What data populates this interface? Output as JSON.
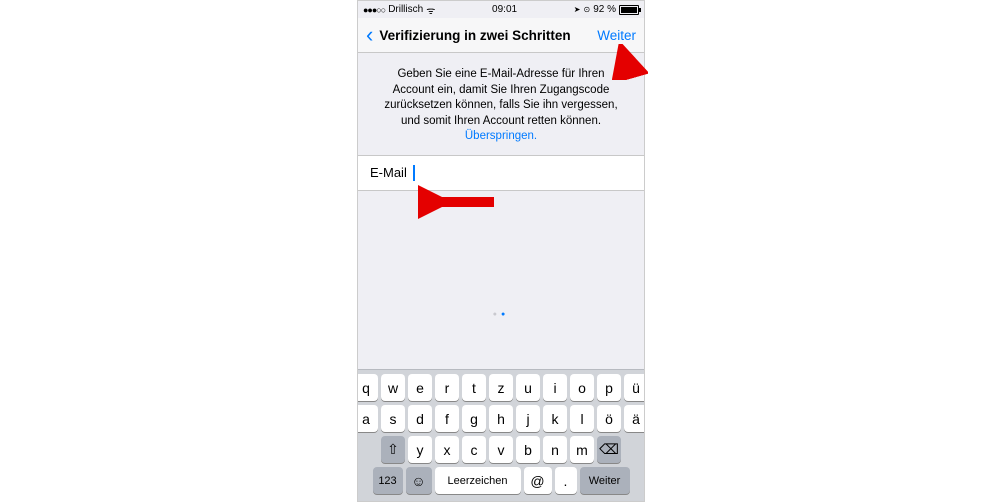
{
  "status": {
    "carrier": "Drillisch",
    "wifi": "ᯤ",
    "time": "09:01",
    "nav": "➤",
    "alarm": "⏰",
    "battery_pct": "92 %"
  },
  "nav": {
    "back": "‹",
    "title": "Verifizierung in zwei Schritten",
    "next": "Weiter"
  },
  "description": {
    "text": "Geben Sie eine E-Mail-Adresse für Ihren Account ein, damit Sie Ihren Zugangscode zurücksetzen können, falls Sie ihn vergessen, und somit Ihren Account retten können. ",
    "skip": "Überspringen."
  },
  "field": {
    "label": "E-Mail",
    "value": ""
  },
  "keyboard": {
    "row1": [
      "q",
      "w",
      "e",
      "r",
      "t",
      "z",
      "u",
      "i",
      "o",
      "p",
      "ü"
    ],
    "row2": [
      "a",
      "s",
      "d",
      "f",
      "g",
      "h",
      "j",
      "k",
      "l",
      "ö",
      "ä"
    ],
    "row3": [
      "y",
      "x",
      "c",
      "v",
      "b",
      "n",
      "m"
    ],
    "shift": "⇧",
    "backspace": "⌫",
    "numbers": "123",
    "emoji": "☺",
    "space": "Leerzeichen",
    "at": "@",
    "period": ".",
    "go": "Weiter"
  }
}
